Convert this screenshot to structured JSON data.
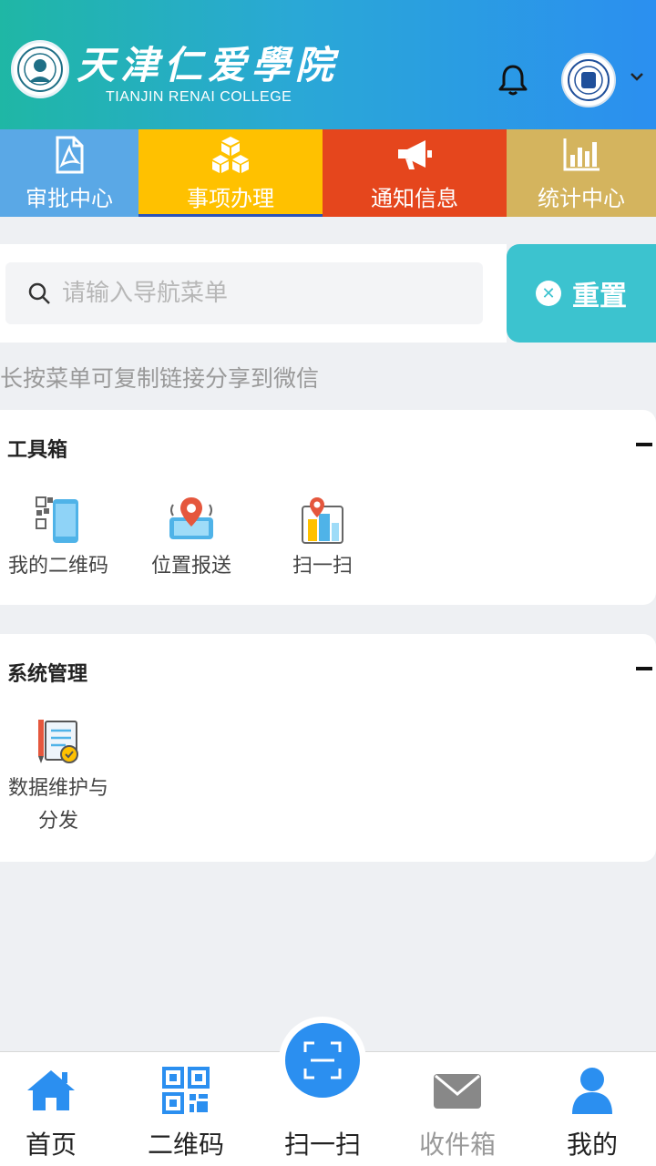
{
  "header": {
    "title": "天津仁爱學院",
    "subtitle": "TIANJIN RENAI COLLEGE"
  },
  "tabs": [
    {
      "label": "审批中心",
      "icon": "pdf-document-icon",
      "color": "#5aa8e6"
    },
    {
      "label": "事项办理",
      "icon": "cubes-icon",
      "color": "#ffc100",
      "active": true
    },
    {
      "label": "通知信息",
      "icon": "megaphone-icon",
      "color": "#e5461d"
    },
    {
      "label": "统计中心",
      "icon": "bar-chart-icon",
      "color": "#d4b45e"
    }
  ],
  "search": {
    "placeholder": "请输入导航菜单",
    "value": "",
    "reset_label": "重置"
  },
  "hint": "长按菜单可复制链接分享到微信",
  "toolbox": {
    "title": "工具箱",
    "items": [
      {
        "label": "我的二维码",
        "icon": "qr-phone-icon"
      },
      {
        "label": "位置报送",
        "icon": "location-phone-icon"
      },
      {
        "label": "扫一扫",
        "icon": "scan-building-icon"
      }
    ]
  },
  "system": {
    "title": "系统管理",
    "items": [
      {
        "label_line1": "数据维护与",
        "label_line2": "分发",
        "icon": "data-document-icon"
      }
    ]
  },
  "bottom_nav": [
    {
      "label": "首页",
      "icon": "home-icon"
    },
    {
      "label": "二维码",
      "icon": "qr-code-icon"
    },
    {
      "label": "扫一扫",
      "icon": "scan-icon"
    },
    {
      "label": "收件箱",
      "icon": "envelope-icon",
      "disabled": true
    },
    {
      "label": "我的",
      "icon": "user-icon"
    }
  ],
  "colors": {
    "header_start": "#1fb7a5",
    "header_end": "#2b8ff0",
    "reset": "#3cc3cf",
    "nav_active": "#2b8ff0"
  }
}
